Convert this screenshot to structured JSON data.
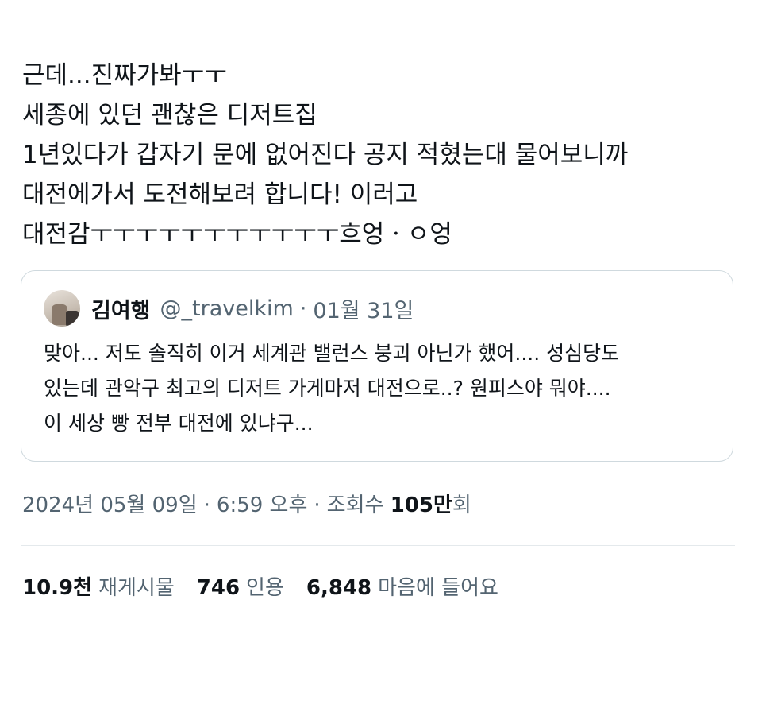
{
  "tweet": {
    "lines": [
      "근데...진짜가봐ㅜㅜ",
      "세종에 있던 괜찮은 디저트집",
      "1년있다가 갑자기 문에 없어진다 공지 적혔는대 물어보니까",
      "대전에가서 도전해보려 합니다! 이러고",
      "대전감ㅜㅜㅜㅜㅜㅜㅜㅜㅜㅜㅜ흐엉ㆍㅇ엉"
    ]
  },
  "quote": {
    "name": "김여행",
    "handle": "@_travelkim",
    "dot": "·",
    "date": "01월 31일",
    "lines": [
      "맞아... 저도 솔직히 이거 세계관 밸런스 붕괴 아닌가 했어.... 성심당도",
      "있는데 관악구 최고의 디저트 가게마저 대전으로..? 원피스야 뭐야....",
      "이 세상 빵 전부 대전에 있냐구..."
    ]
  },
  "meta": {
    "date": "2024년 05월 09일",
    "time": "6:59 오후",
    "sep": "·",
    "views_label": "조회수",
    "views_num": "105만",
    "views_suffix": "회"
  },
  "stats": {
    "reposts_num": "10.9천",
    "reposts_label": "재게시물",
    "quotes_num": "746",
    "quotes_label": "인용",
    "likes_num": "6,848",
    "likes_label": "마음에 들어요"
  },
  "colors": {
    "text": "#0f1419",
    "secondary": "#536471",
    "border": "#cfd9de"
  }
}
